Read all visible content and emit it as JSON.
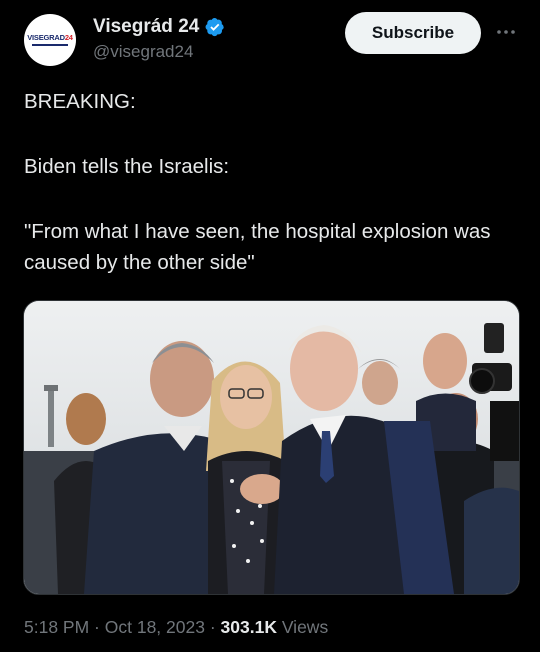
{
  "author": {
    "avatar_logo_text": "VISEGRAD",
    "avatar_logo_num": "24",
    "display_name": "Visegrád 24",
    "handle": "@visegrad24",
    "verified_icon": "verified-badge-icon"
  },
  "actions": {
    "subscribe_label": "Subscribe",
    "more_icon": "more-horizontal-icon"
  },
  "tweet": {
    "line1": "BREAKING:",
    "line2": "Biden tells the Israelis:",
    "line3": "\"From what I have seen, the hospital explosion was caused by the other side\""
  },
  "media": {
    "description_icon": "photo"
  },
  "meta": {
    "time": "5:18 PM",
    "sep1": " · ",
    "date": "Oct 18, 2023",
    "sep2": " · ",
    "views_count": "303.1K",
    "views_label": " Views"
  },
  "colors": {
    "background": "#000000",
    "text": "#e7e9ea",
    "secondary": "#71767b",
    "verified": "#1d9bf0",
    "button_bg": "#eff3f4"
  }
}
